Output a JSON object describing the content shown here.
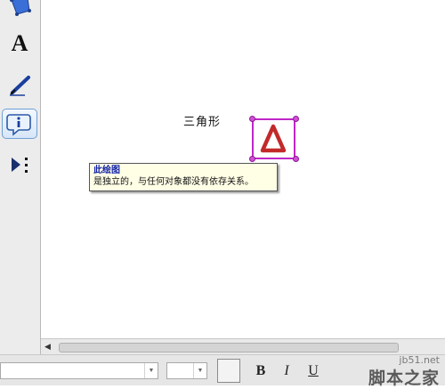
{
  "toolbar": {
    "tools": [
      {
        "name": "custom-polygon-tool"
      },
      {
        "name": "text-tool",
        "glyph": "A"
      },
      {
        "name": "marker-tool"
      },
      {
        "name": "information-tool"
      },
      {
        "name": "custom-tool-menu"
      }
    ]
  },
  "canvas": {
    "label": "三角形",
    "picture": {
      "shape": "triangle",
      "stroke_color": "#c22a2a",
      "frame_color": "#c026c8"
    }
  },
  "tooltip": {
    "title": "此绘图",
    "body": "是独立的，与任何对象都没有依存关系。"
  },
  "formatbar": {
    "font_family_value": "",
    "font_size_value": "",
    "bold_label": "B",
    "italic_label": "I",
    "underline_label": "U"
  },
  "watermark": {
    "url": "jb51.net",
    "text": "脚本之家"
  }
}
